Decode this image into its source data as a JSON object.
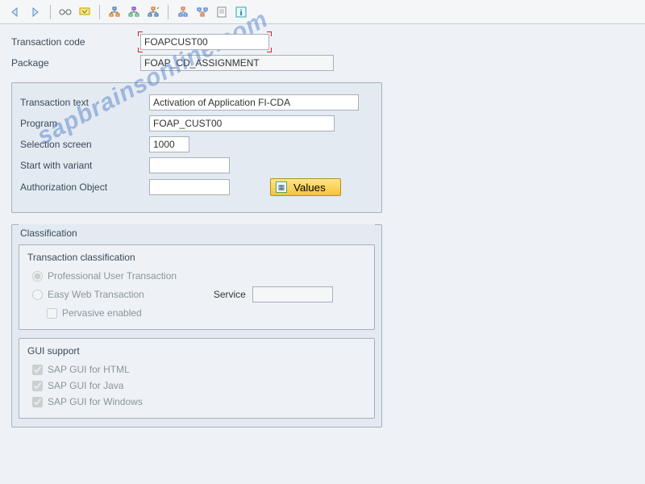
{
  "watermark": "sapbrainsonline.com",
  "header": {
    "transaction_code_label": "Transaction code",
    "transaction_code_value": "FOAPCUST00",
    "package_label": "Package",
    "package_value": "FOAP_CD_ASSIGNMENT"
  },
  "details": {
    "transaction_text_label": "Transaction text",
    "transaction_text_value": "Activation of Application FI-CDA",
    "program_label": "Program",
    "program_value": "FOAP_CUST00",
    "selection_screen_label": "Selection screen",
    "selection_screen_value": "1000",
    "start_variant_label": "Start with variant",
    "start_variant_value": "",
    "auth_object_label": "Authorization Object",
    "auth_object_value": "",
    "values_button": "Values"
  },
  "classification": {
    "title": "Classification",
    "transaction_classification": {
      "title": "Transaction classification",
      "professional": "Professional User Transaction",
      "easy_web": "Easy Web Transaction",
      "service_label": "Service",
      "service_value": "",
      "pervasive": "Pervasive enabled"
    },
    "gui_support": {
      "title": "GUI support",
      "html": "SAP GUI for HTML",
      "java": "SAP GUI for Java",
      "windows": "SAP GUI for Windows"
    }
  }
}
